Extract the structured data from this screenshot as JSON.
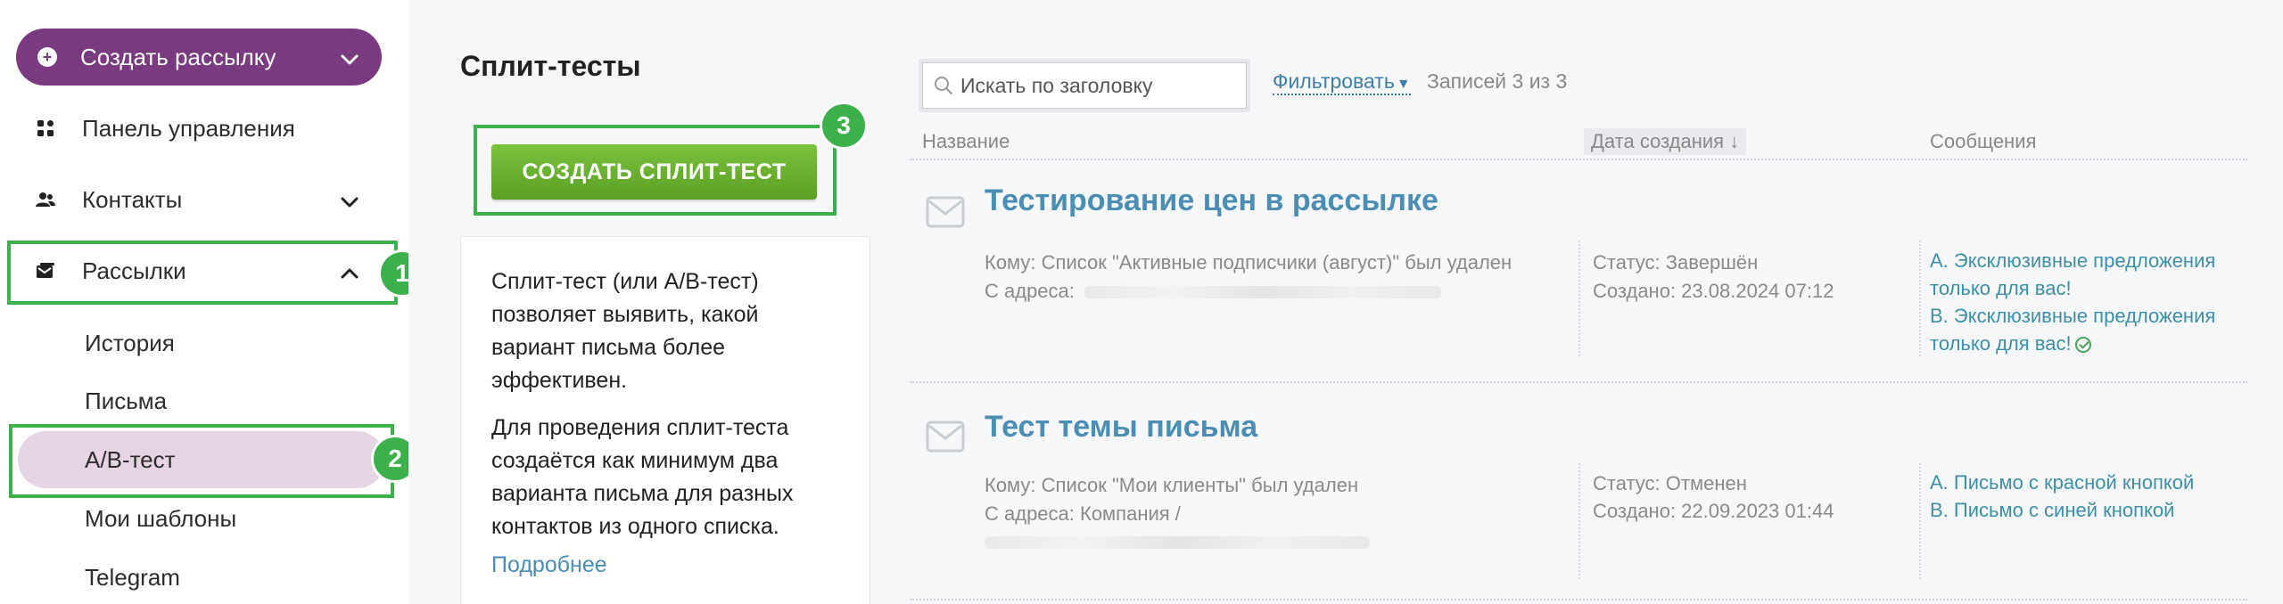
{
  "sidebar": {
    "create_mailing": "Создать рассылку",
    "items": [
      {
        "label": "Панель управления"
      },
      {
        "label": "Контакты"
      },
      {
        "label": "Рассылки"
      }
    ],
    "sub_items": [
      {
        "label": "История"
      },
      {
        "label": "Письма"
      },
      {
        "label": "A/B-тест"
      },
      {
        "label": "Мои шаблоны"
      },
      {
        "label": "Telegram"
      }
    ]
  },
  "badges": [
    "1",
    "2",
    "3"
  ],
  "main": {
    "title": "Сплит-тесты",
    "create_button": "СОЗДАТЬ СПЛИТ-ТЕСТ",
    "info": {
      "p1": "Сплит-тест (или A/B-тест) позволяет выявить, какой вариант письма более эффективен.",
      "p2": "Для проведения сплит-теста создаётся как минимум два варианта письма для разных контактов из одного списка.",
      "more": "Подробнее"
    }
  },
  "table": {
    "search_placeholder": "Искать по заголовку",
    "filter_label": "Фильтровать",
    "records": "Записей 3 из 3",
    "columns": {
      "name": "Название",
      "date": "Дата создания ↓",
      "messages": "Сообщения"
    },
    "rows": [
      {
        "title": "Тестирование цен в рассылке",
        "to": "Кому: Список \"Активные подписчики (август)\" был удален",
        "from": "С адреса:",
        "status": "Статус: Завершён",
        "created": "Создано: 23.08.2024 07:12",
        "msg_a_1": "A. Эксклюзивные предложения",
        "msg_a_2": "только для вас!",
        "msg_b_1": "B. Эксклюзивные предложения",
        "msg_b_2": "только для вас!"
      },
      {
        "title": "Тест темы письма",
        "to": "Кому: Список \"Мои клиенты\" был удален",
        "from": "С адреса: Компания /",
        "status": "Статус: Отменен",
        "created": "Создано: 22.09.2023 01:44",
        "msg_a_1": "A. Письмо с красной кнопкой",
        "msg_b_1": "B. Письмо с синей кнопкой"
      }
    ]
  },
  "colors": {
    "brand_purple": "#7a3a80",
    "active_pink": "#e6d3e3",
    "highlight_green": "#3cb04a",
    "button_green": "#6bb131",
    "link_blue": "#4a8db5"
  },
  "icons": [
    "plus-circle-icon",
    "chevron-down-icon",
    "dashboard-grid-icon",
    "contacts-icon",
    "mail-icon",
    "chevron-up-icon",
    "search-icon",
    "envelope-icon",
    "check-circle-icon"
  ]
}
